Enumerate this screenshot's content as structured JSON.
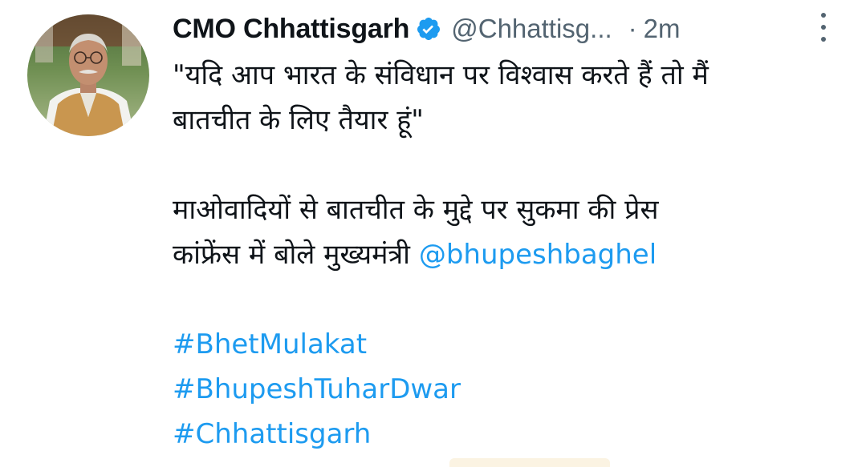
{
  "tweet": {
    "author": {
      "display_name": "CMO Chhattisgarh",
      "handle": "@Chhattisg...",
      "verified": true
    },
    "separator": "·",
    "time": "2m",
    "body": {
      "quote_line1": "\"यदि आप भारत के संविधान पर विश्वास करते हैं तो मैं",
      "quote_line2": "बातचीत के लिए तैयार हूं\"",
      "para_line1": "माओवादियों से बातचीत के मुद्दे पर सुकमा की प्रेस",
      "para_line2_prefix": "कांफ्रेंस में बोले मुख्यमंत्री",
      "mention": "@bhupeshbaghel"
    },
    "hashtags": [
      "#BhetMulakat",
      "#BhupeshTuharDwar",
      "#Chhattisgarh"
    ]
  },
  "colors": {
    "link": "#1d9bf0",
    "secondary_text": "#536471",
    "primary_text": "#0f1419"
  },
  "icons": {
    "verified": "verified-badge-icon",
    "more": "more-options-icon"
  }
}
